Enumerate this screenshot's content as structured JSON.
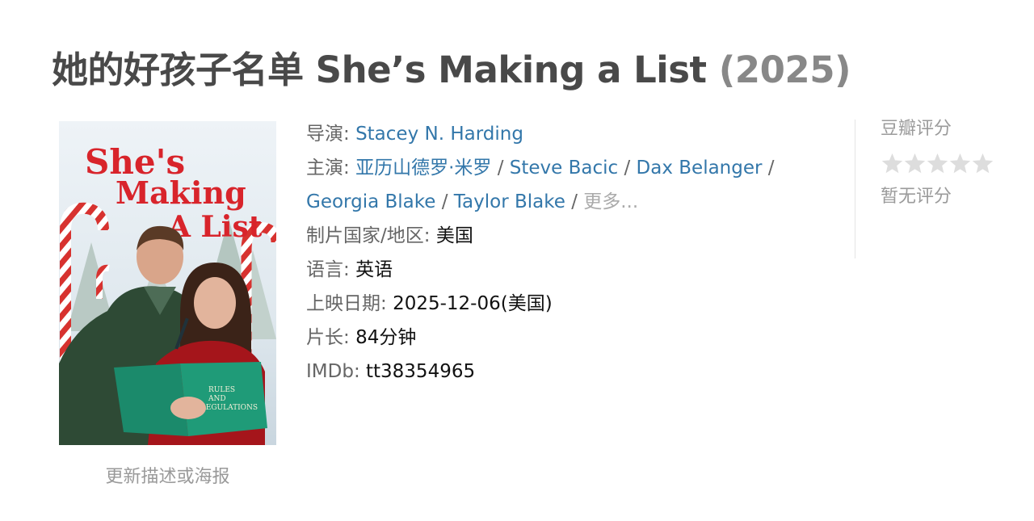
{
  "title": {
    "name": "她的好孩子名单 She’s Making a List",
    "year": "(2025)"
  },
  "poster": {
    "title_lines": [
      "She's",
      "Making",
      "A List"
    ],
    "book_text": [
      "RULES",
      "AND",
      "REGULATIONS"
    ],
    "update_link": "更新描述或海报"
  },
  "info": {
    "director_label": "导演",
    "director": "Stacey N. Harding",
    "cast_label": "主演",
    "cast": [
      "亚历山德罗·米罗",
      "Steve Bacic",
      "Dax Belanger",
      "Georgia Blake",
      "Taylor Blake"
    ],
    "cast_separator": "/",
    "more": "更多...",
    "country_label": "制片国家/地区",
    "country": "美国",
    "language_label": "语言",
    "language": "英语",
    "release_label": "上映日期",
    "release": "2025-12-06(美国)",
    "runtime_label": "片长",
    "runtime": "84分钟",
    "imdb_label": "IMDb",
    "imdb": "tt38354965",
    "colon": ":"
  },
  "rating": {
    "label": "豆瓣评分",
    "value": "暂无评分",
    "stars_filled": 0,
    "stars_total": 5,
    "star_color": "#dddddd"
  },
  "colors": {
    "link": "#3377aa",
    "title": "#494949",
    "year": "#888888",
    "label": "#666666"
  }
}
